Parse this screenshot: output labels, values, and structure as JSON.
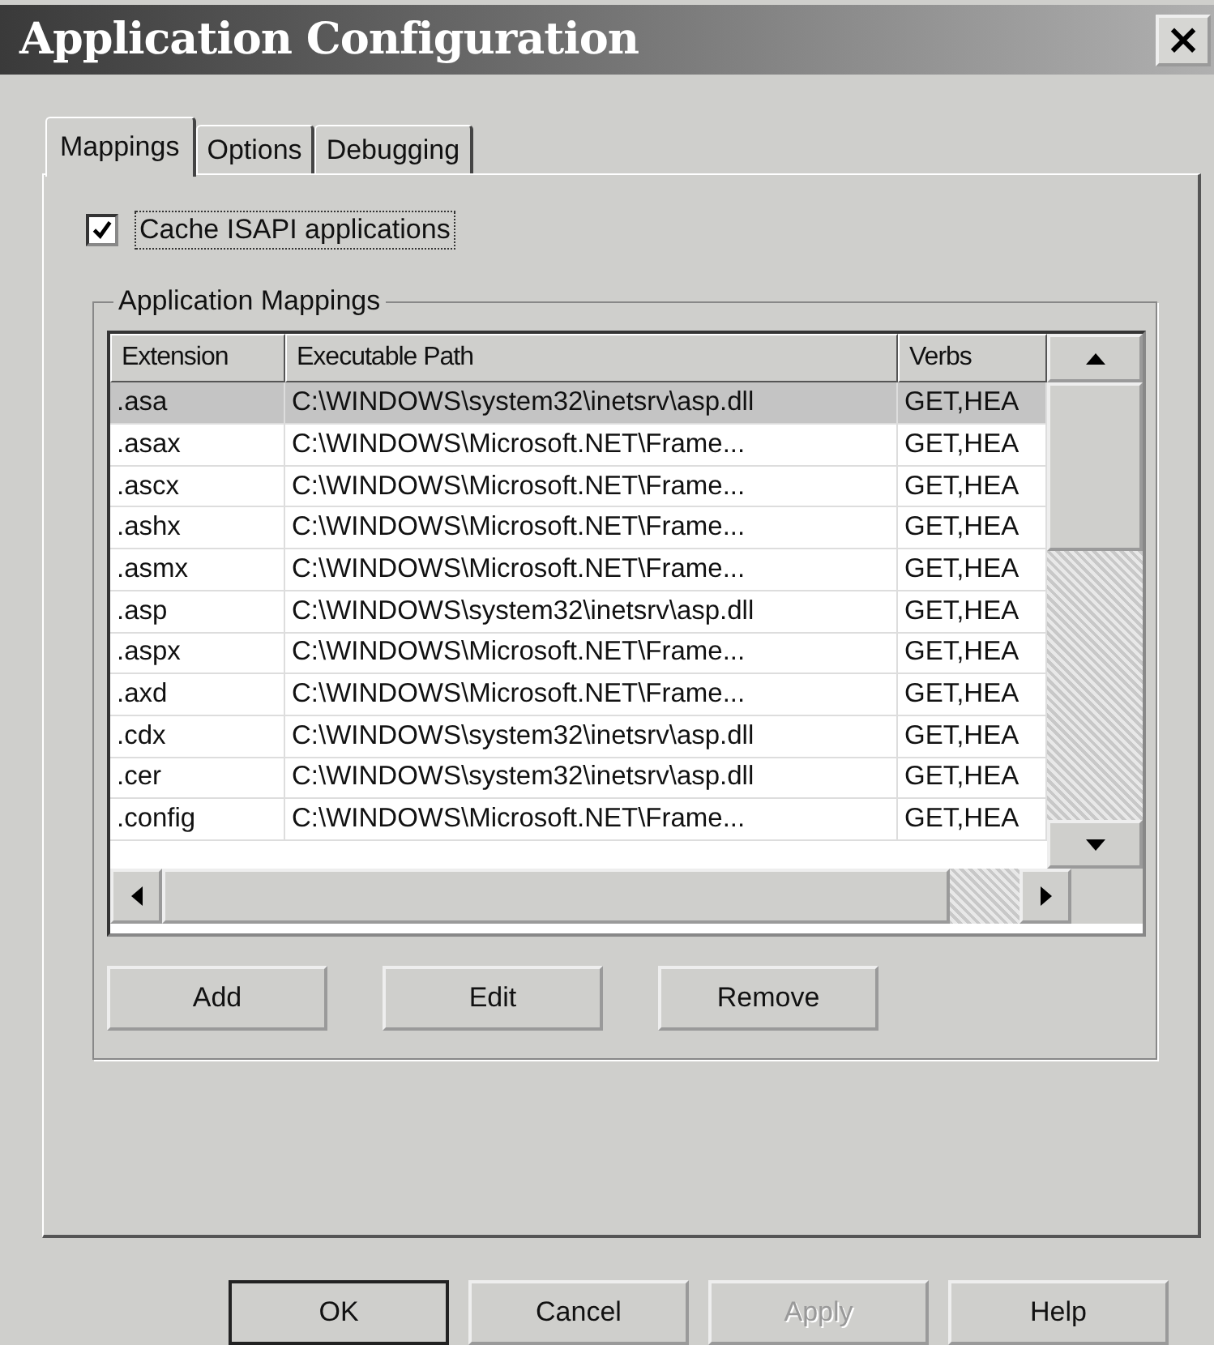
{
  "window": {
    "title": "Application Configuration",
    "close": "×"
  },
  "tabs": [
    {
      "label": "Mappings",
      "selected": true
    },
    {
      "label": "Options",
      "selected": false
    },
    {
      "label": "Debugging",
      "selected": false
    }
  ],
  "cache_checkbox": {
    "label": "Cache ISAPI applications",
    "checked": true
  },
  "group": {
    "title": "Application Mappings"
  },
  "table": {
    "columns": [
      "Extension",
      "Executable Path",
      "Verbs"
    ],
    "rows": [
      {
        "cells": [
          ".asa",
          "C:\\WINDOWS\\system32\\inetsrv\\asp.dll",
          "GET,HEA"
        ],
        "selected": true
      },
      {
        "cells": [
          ".asax",
          "C:\\WINDOWS\\Microsoft.NET\\Frame...",
          "GET,HEA"
        ],
        "selected": false
      },
      {
        "cells": [
          ".ascx",
          "C:\\WINDOWS\\Microsoft.NET\\Frame...",
          "GET,HEA"
        ],
        "selected": false
      },
      {
        "cells": [
          ".ashx",
          "C:\\WINDOWS\\Microsoft.NET\\Frame...",
          "GET,HEA"
        ],
        "selected": false
      },
      {
        "cells": [
          ".asmx",
          "C:\\WINDOWS\\Microsoft.NET\\Frame...",
          "GET,HEA"
        ],
        "selected": false
      },
      {
        "cells": [
          ".asp",
          "C:\\WINDOWS\\system32\\inetsrv\\asp.dll",
          "GET,HEA"
        ],
        "selected": false
      },
      {
        "cells": [
          ".aspx",
          "C:\\WINDOWS\\Microsoft.NET\\Frame...",
          "GET,HEA"
        ],
        "selected": false
      },
      {
        "cells": [
          ".axd",
          "C:\\WINDOWS\\Microsoft.NET\\Frame...",
          "GET,HEA"
        ],
        "selected": false
      },
      {
        "cells": [
          ".cdx",
          "C:\\WINDOWS\\system32\\inetsrv\\asp.dll",
          "GET,HEA"
        ],
        "selected": false
      },
      {
        "cells": [
          ".cer",
          "C:\\WINDOWS\\system32\\inetsrv\\asp.dll",
          "GET,HEA"
        ],
        "selected": false
      },
      {
        "cells": [
          ".config",
          "C:\\WINDOWS\\Microsoft.NET\\Frame...",
          "GET,HEA"
        ],
        "selected": false
      }
    ]
  },
  "mapping_buttons": [
    {
      "label": "Add"
    },
    {
      "label": "Edit"
    },
    {
      "label": "Remove"
    }
  ],
  "dialog_buttons": [
    {
      "label": "OK",
      "disabled": false,
      "default": true
    },
    {
      "label": "Cancel",
      "disabled": false,
      "default": false
    },
    {
      "label": "Apply",
      "disabled": true,
      "default": false
    },
    {
      "label": "Help",
      "disabled": false,
      "default": false
    }
  ]
}
